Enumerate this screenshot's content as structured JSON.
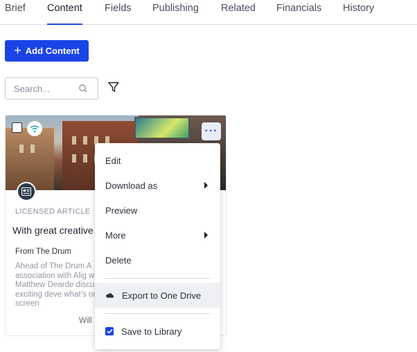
{
  "tabs": [
    {
      "label": "Brief"
    },
    {
      "label": "Content"
    },
    {
      "label": "Fields"
    },
    {
      "label": "Publishing"
    },
    {
      "label": "Related"
    },
    {
      "label": "Financials"
    },
    {
      "label": "History"
    }
  ],
  "active_tab": "Content",
  "toolbar": {
    "add_label": "Add Content"
  },
  "search": {
    "placeholder": "Search...",
    "value": ""
  },
  "card": {
    "tag": "LICENSED ARTICLE",
    "title": "With great creative",
    "source": "From The Drum",
    "description": "Ahead of The Drum A association with Alig with Matthew Dearde discuss exciting deve what’s on the screen",
    "byline": "Will",
    "more_label": "···"
  },
  "menu": {
    "edit": "Edit",
    "download": "Download as",
    "preview": "Preview",
    "more": "More",
    "delete": "Delete",
    "export": "Export to One Drive",
    "save": "Save to Library",
    "save_checked": true
  },
  "colors": {
    "accent": "#1a44e6",
    "badge": "#2b3a4a",
    "wifi": "#1fb3a8"
  }
}
